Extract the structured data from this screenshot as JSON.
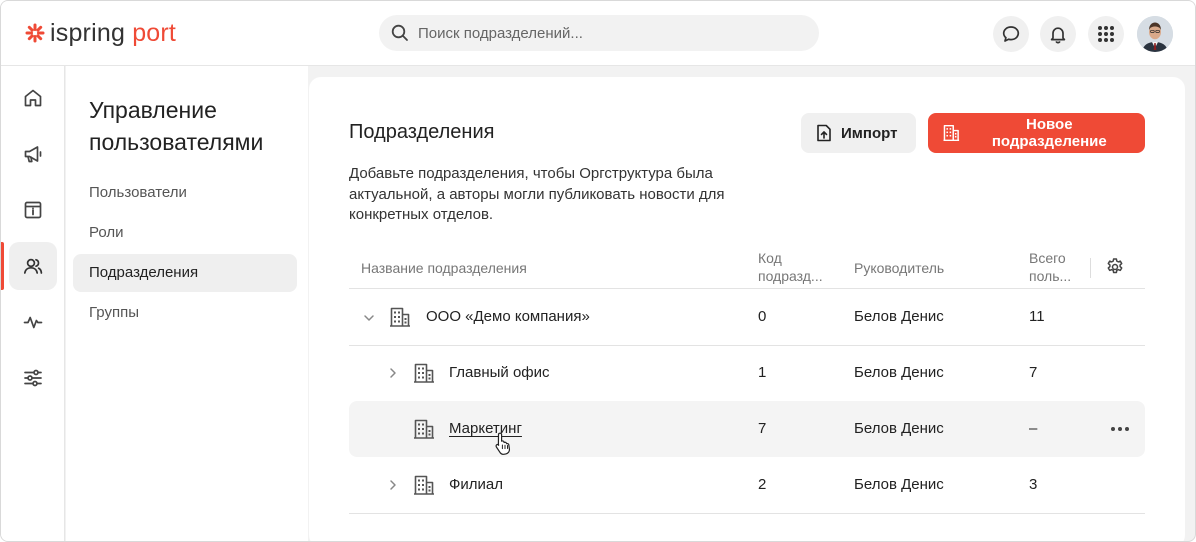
{
  "brand": {
    "name_part1": "ispring",
    "name_part2": "port",
    "accent_color": "#ef4a36"
  },
  "search": {
    "placeholder": "Поиск подразделений...",
    "value": ""
  },
  "header_icons": [
    "chat-icon",
    "bell-icon",
    "apps-grid-icon",
    "avatar"
  ],
  "rail": {
    "items": [
      "home-icon",
      "megaphone-icon",
      "info-board-icon",
      "users-icon",
      "activity-icon",
      "settings-sliders-icon"
    ],
    "active": "users-icon"
  },
  "subnav": {
    "title": "Управление пользователями",
    "items": [
      {
        "label": "Пользователи",
        "active": false
      },
      {
        "label": "Роли",
        "active": false
      },
      {
        "label": "Подразделения",
        "active": true
      },
      {
        "label": "Группы",
        "active": false
      }
    ]
  },
  "main": {
    "title": "Подразделения",
    "description": "Добавьте подразделения, чтобы Оргструктура была актуальной, а авторы могли публиковать новости для конкретных отделов.",
    "import_label": "Импорт",
    "new_label": "Новое подразделение"
  },
  "table": {
    "columns": [
      {
        "label": "Название подразделения"
      },
      {
        "label": "Код подразд..."
      },
      {
        "label": "Руководитель"
      },
      {
        "label": "Всего поль..."
      }
    ],
    "rows": [
      {
        "name": "ООО «Демо компания»",
        "code": "0",
        "manager": "Белов Денис",
        "total": "11",
        "level": 0,
        "expander": "expanded"
      },
      {
        "name": "Главный офис",
        "code": "1",
        "manager": "Белов Денис",
        "total": "7",
        "level": 1,
        "expander": "collapsed"
      },
      {
        "name": "Маркетинг",
        "code": "7",
        "manager": "Белов Денис",
        "total": "–",
        "level": 1,
        "expander": "none",
        "hovered": true
      },
      {
        "name": "Филиал",
        "code": "2",
        "manager": "Белов Денис",
        "total": "3",
        "level": 1,
        "expander": "collapsed"
      }
    ]
  }
}
